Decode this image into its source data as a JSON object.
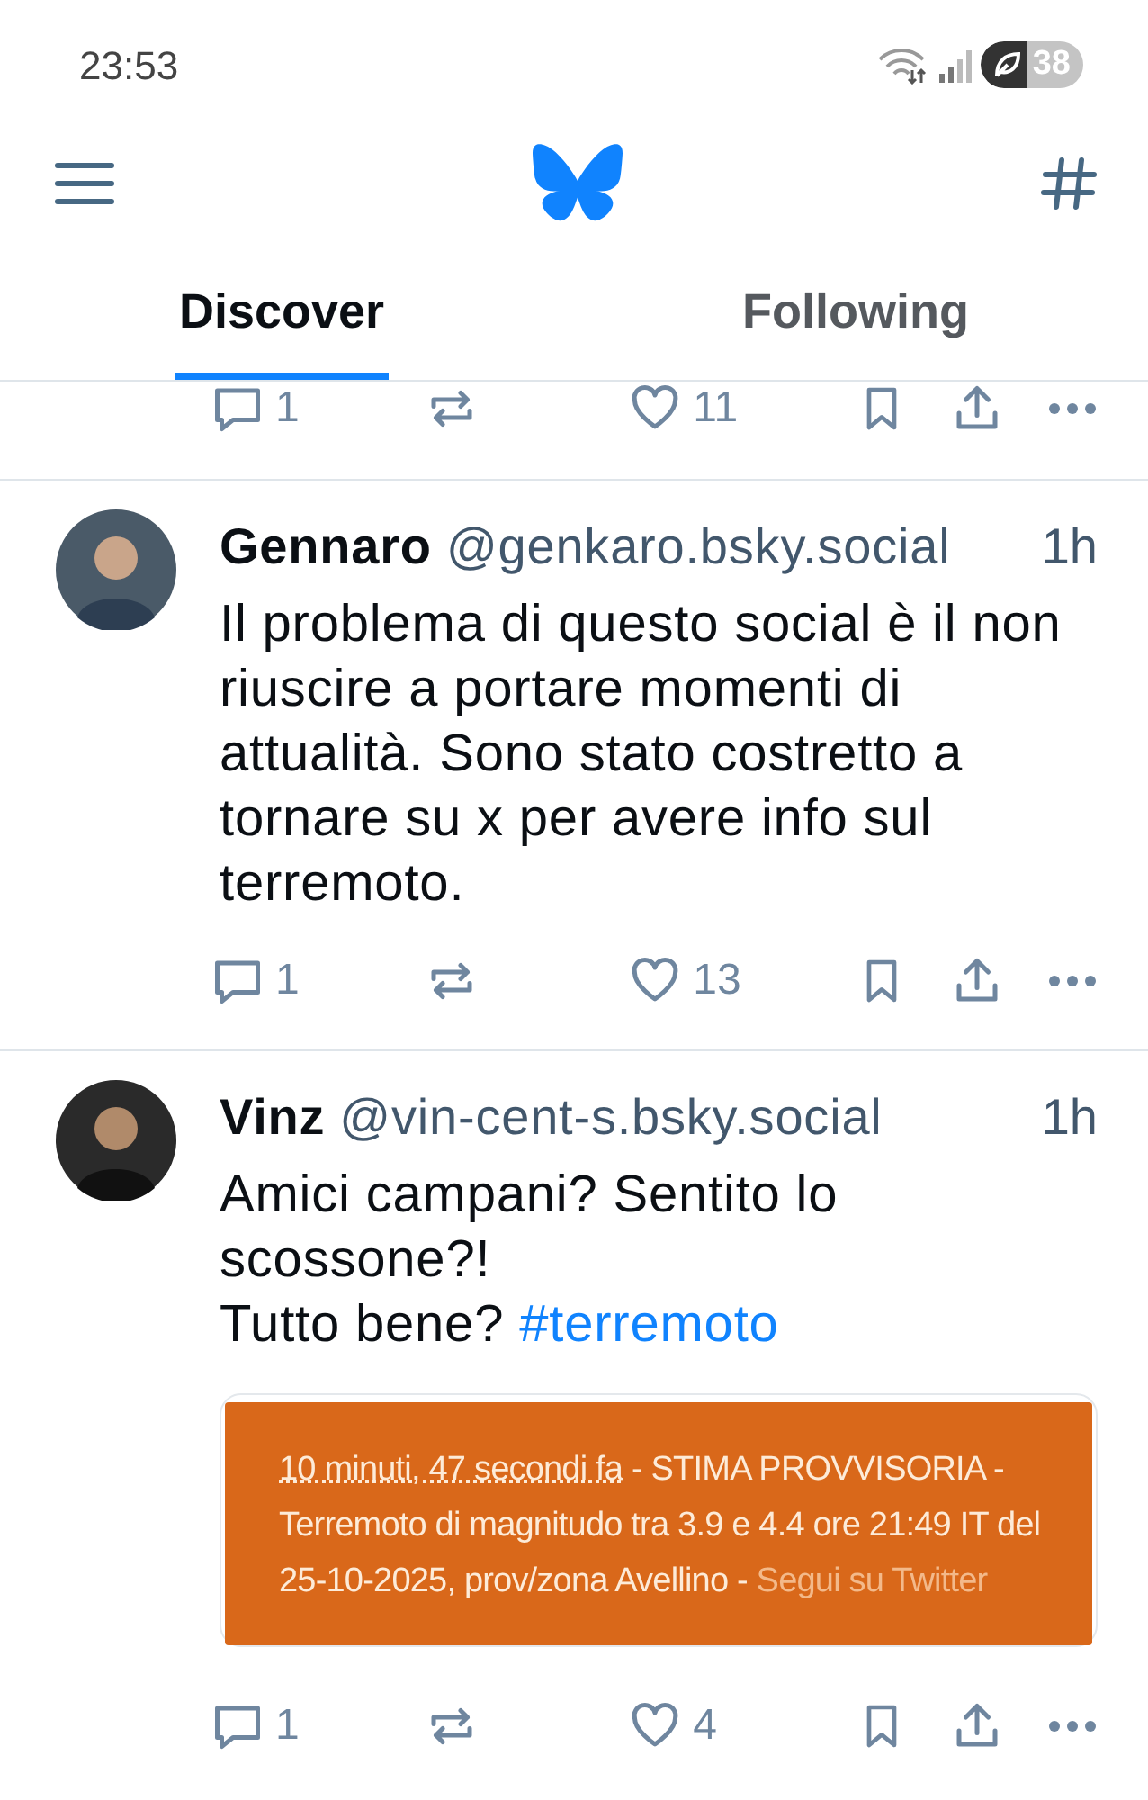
{
  "status_bar": {
    "time": "23:53",
    "battery": "38"
  },
  "tabs": [
    {
      "label": "Discover",
      "selected": true
    },
    {
      "label": "Following",
      "selected": false
    }
  ],
  "partial_post": {
    "replies": "1",
    "likes": "11"
  },
  "posts": [
    {
      "name": "Gennaro",
      "handle": "@genkaro.bsky.social",
      "time": "1h",
      "text": [
        {
          "kind": "plain",
          "text": "Il problema di questo social è il non riuscire a portare momenti di attualità. Sono stato costretto a tornare su x per avere info sul terremoto."
        }
      ],
      "replies": "1",
      "likes": "13"
    },
    {
      "name": "Vinz",
      "handle": "@vin-cent-s.bsky.social",
      "time": "1h",
      "text": [
        {
          "kind": "plain",
          "text": "Amici campani? Sentito lo scossone?!\nTutto bene? "
        },
        {
          "kind": "hashtag",
          "text": "#terremoto"
        }
      ],
      "embed": [
        {
          "kind": "link",
          "text": "10 minuti, 47 secondi fa"
        },
        {
          "kind": "plain",
          "text": " - STIMA PROVVISORIA - Terremoto di magnitudo tra 3.9 e 4.4 ore 21:49 IT del 25-10-2025, prov/zona Avellino - "
        },
        {
          "kind": "muted",
          "text": "Segui su Twitter"
        }
      ],
      "replies": "1",
      "likes": "4"
    }
  ]
}
